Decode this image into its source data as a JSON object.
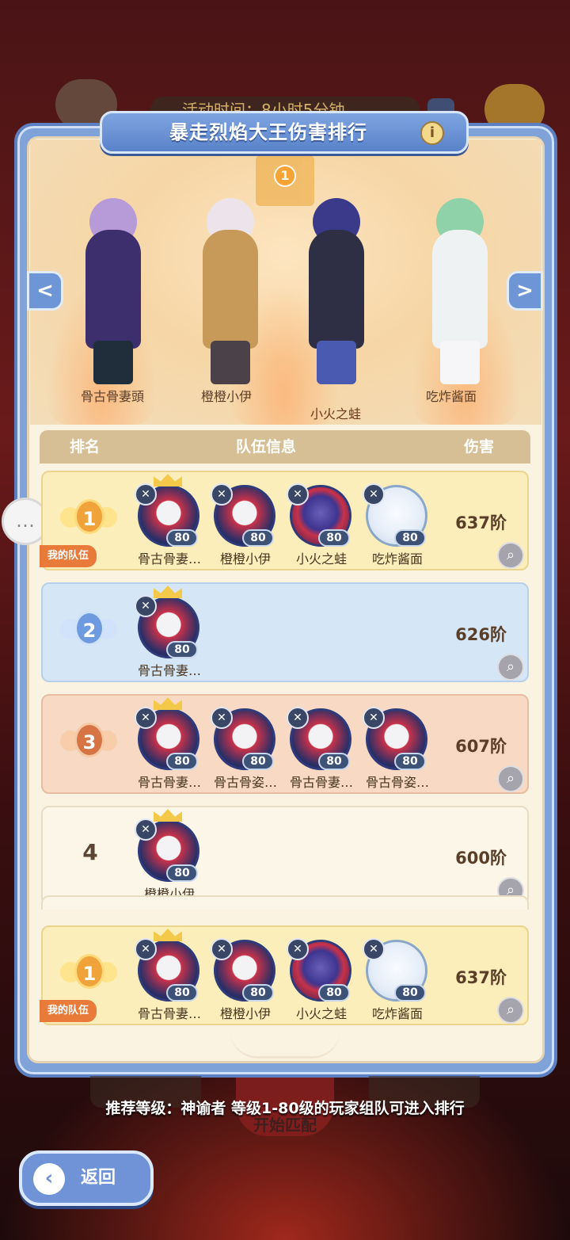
{
  "top_hud": {
    "timer_text": "活动时间：8小时5分钟"
  },
  "panel": {
    "title": "暴走烈焰大王伤害排行",
    "info_icon": "i",
    "podium_rank": "1",
    "characters": [
      {
        "name": "骨古骨妻頭"
      },
      {
        "name": "橙橙小伊"
      },
      {
        "name": "小火之蛙"
      },
      {
        "name": "吃炸酱面"
      }
    ],
    "nav_left": "<",
    "nav_right": ">"
  },
  "table": {
    "headers": {
      "rank": "排名",
      "team": "队伍信息",
      "damage": "伤害"
    },
    "my_team_tag": "我的队伍",
    "rows": [
      {
        "rank": "1",
        "style": "gold",
        "is_mine": true,
        "damage": "637阶",
        "members": [
          {
            "name": "骨古骨妻…",
            "level": "80",
            "avatar": "red",
            "crown": true
          },
          {
            "name": "橙橙小伊",
            "level": "80",
            "avatar": "red",
            "crown": false
          },
          {
            "name": "小火之蛙",
            "level": "80",
            "avatar": "purple",
            "crown": false
          },
          {
            "name": "吃炸酱面",
            "level": "80",
            "avatar": "white",
            "crown": false
          }
        ]
      },
      {
        "rank": "2",
        "style": "silver",
        "is_mine": false,
        "damage": "626阶",
        "members": [
          {
            "name": "骨古骨妻…",
            "level": "80",
            "avatar": "red",
            "crown": true
          }
        ]
      },
      {
        "rank": "3",
        "style": "bronze",
        "is_mine": false,
        "damage": "607阶",
        "members": [
          {
            "name": "骨古骨妻…",
            "level": "80",
            "avatar": "red",
            "crown": true
          },
          {
            "name": "骨古骨姿…",
            "level": "80",
            "avatar": "red",
            "crown": false
          },
          {
            "name": "骨古骨妻…",
            "level": "80",
            "avatar": "red",
            "crown": false
          },
          {
            "name": "骨古骨姿…",
            "level": "80",
            "avatar": "red",
            "crown": false
          }
        ]
      },
      {
        "rank": "4",
        "style": "plain",
        "is_mine": false,
        "damage": "600阶",
        "members": [
          {
            "name": "橙橙小伊",
            "level": "80",
            "avatar": "red",
            "crown": true
          }
        ]
      }
    ],
    "my_row": {
      "rank": "1",
      "style": "gold",
      "is_mine": true,
      "damage": "637阶",
      "members": [
        {
          "name": "骨古骨妻…",
          "level": "80",
          "avatar": "red",
          "crown": true
        },
        {
          "name": "橙橙小伊",
          "level": "80",
          "avatar": "red",
          "crown": false
        },
        {
          "name": "小火之蛙",
          "level": "80",
          "avatar": "purple",
          "crown": false
        },
        {
          "name": "吃炸酱面",
          "level": "80",
          "avatar": "white",
          "crown": false
        }
      ]
    }
  },
  "footer": {
    "recommend": "推荐等级：神谕者  等级1-80级的玩家组队可进入排行",
    "start_label": "开始匹配",
    "back_label": "返回"
  },
  "colors": {
    "panel_blue": "#7fa3d8",
    "paper": "#fbf3e2",
    "gold_row": "#fbeeba",
    "silver_row": "#d5e6f6",
    "bronze_row": "#f7d9c4",
    "my_tag": "#e87a3a"
  },
  "icons": [
    "shop-icon",
    "clock-icon",
    "gift-icon",
    "info-icon",
    "chevron-left-icon",
    "chevron-right-icon",
    "chat-icon",
    "zoom-icon",
    "class-icon",
    "crown-icon",
    "back-arrow-icon"
  ]
}
